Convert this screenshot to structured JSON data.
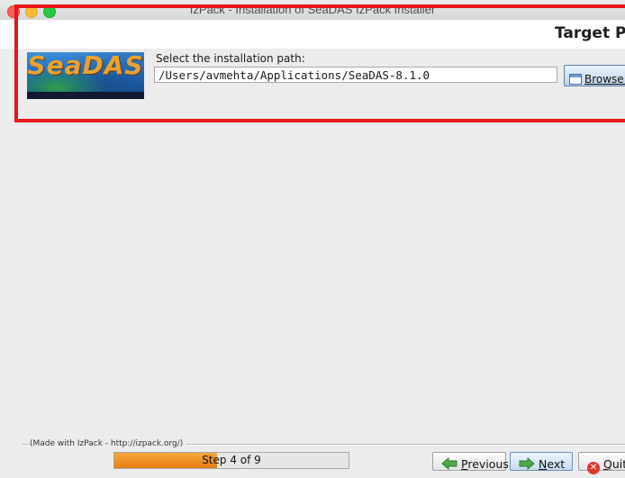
{
  "window": {
    "title": "IzPack - Installation of  SeaDAS IzPack Installer"
  },
  "panel": {
    "title": "Target Pa"
  },
  "logo": {
    "text": "SeaDAS"
  },
  "install_path": {
    "label": "Select the installation path:",
    "value": "/Users/avmehta/Applications/SeaDAS-8.1.0"
  },
  "browse_button": {
    "label": "Browse..",
    "icon": "folder-icon"
  },
  "footer": {
    "made_with": "(Made with IzPack - http://izpack.org/)",
    "progress_label": "Step 4 of 9",
    "progress_fraction": 0.44,
    "previous_label": "Previous",
    "previous_mnemonic": "P",
    "previous_rest": "revious",
    "next_mnemonic": "N",
    "next_rest": "ext",
    "quit_mnemonic": "Q",
    "quit_rest": "uit"
  },
  "colors": {
    "highlight": "#e8141b",
    "progress_fill": "#f08f1f",
    "accent": "#5a7fa8"
  }
}
